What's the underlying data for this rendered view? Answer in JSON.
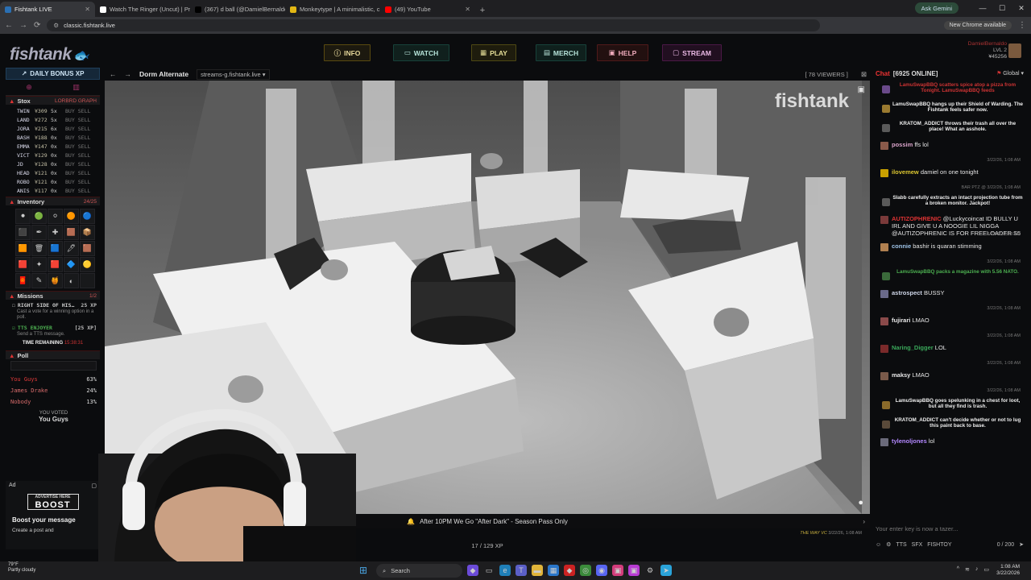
{
  "browser": {
    "tabs": [
      {
        "title": "Fishtank LIVE",
        "active": true,
        "color": "#2a6fb3"
      },
      {
        "title": "Watch The Ringer (Uncut) | Pri",
        "active": false,
        "color": "#ffffff"
      },
      {
        "title": "(367) d ball (@DamielBernaldo",
        "active": false,
        "color": "#000000"
      },
      {
        "title": "Monkeytype | A minimalistic, c",
        "active": false,
        "color": "#e2b714"
      },
      {
        "title": "(49) YouTube",
        "active": false,
        "color": "#ff0000"
      }
    ],
    "url": "classic.fishtank.live",
    "ask_gemini": "Ask Gemini",
    "new_chrome": "New Chrome available"
  },
  "header": {
    "logo": "fishtank",
    "nav": [
      "INFO",
      "WATCH",
      "PLAY",
      "MERCH",
      "HELP",
      "STREAM"
    ],
    "user_name": "DamielBernaldo",
    "user_level": "LVL 2",
    "user_credits": "¥45256"
  },
  "left": {
    "daily_bonus": "DAILY BONUS XP",
    "stox": {
      "title": "Stox",
      "links": "LORBRD  GRAPH",
      "rows": [
        {
          "ticker": "TWIN",
          "price": "¥309",
          "mult": "5x"
        },
        {
          "ticker": "LAND",
          "price": "¥272",
          "mult": "5x"
        },
        {
          "ticker": "JORA",
          "price": "¥215",
          "mult": "6x"
        },
        {
          "ticker": "BASH",
          "price": "¥188",
          "mult": "0x"
        },
        {
          "ticker": "EMMA",
          "price": "¥147",
          "mult": "0x"
        },
        {
          "ticker": "VICT",
          "price": "¥129",
          "mult": "0x"
        },
        {
          "ticker": "JD",
          "price": "¥128",
          "mult": "0x"
        },
        {
          "ticker": "HEAD",
          "price": "¥121",
          "mult": "0x"
        },
        {
          "ticker": "ROBO",
          "price": "¥121",
          "mult": "0x"
        },
        {
          "ticker": "ANIS",
          "price": "¥117",
          "mult": "0x"
        }
      ],
      "buy": "BUY",
      "sell": "SELL"
    },
    "inventory": {
      "title": "Inventory",
      "count": "24/25"
    },
    "missions": {
      "title": "Missions",
      "count": "1/2",
      "items": [
        {
          "name": "RIGHT SIDE OF HIS…",
          "xp": "25 XP",
          "desc": "Cast a vote for a winning option in a poll."
        },
        {
          "name": "TTS ENJOYER",
          "xp": "[25 XP]",
          "desc": "Send a TTS message."
        }
      ],
      "time_label": "TIME REMAINING",
      "time_value": "15:38:31"
    },
    "poll": {
      "title": "Poll",
      "options": [
        {
          "name": "You Guys",
          "pct": "63%",
          "fill": 0.63
        },
        {
          "name": "James Drake",
          "pct": "24%",
          "fill": 0.24
        },
        {
          "name": "Nobody",
          "pct": "13%",
          "fill": 0.13
        }
      ],
      "voted_label": "YOU VOTED",
      "voted_value": "You Guys"
    },
    "ad": {
      "label": "Ad",
      "advertise": "ADVERTISE HERE",
      "boost": "BOOST",
      "title": "Boost your message",
      "desc": "Create a post and"
    }
  },
  "stream": {
    "room": "Dorm Alternate",
    "server": "streams-g.fishtank.live",
    "viewers": "[ 78 VIEWERS ]",
    "watermark": "fishtank",
    "ticker": "After 10PM We Go \"After Dark\" - Season Pass Only",
    "ticker_who": "THE WAY VC",
    "ticker_time": "3/22/26, 1:08 AM",
    "pager": "17 / 129 XP"
  },
  "chat": {
    "title": "Chat",
    "online": "[6925 ONLINE]",
    "room": "Global",
    "messages": [
      {
        "type": "sys",
        "text": "LamuSwapBBQ scatters spice atop a pizza from Tonight. LamuSwapBBQ feeds",
        "color": "#c33"
      },
      {
        "type": "sys",
        "text": "LamuSwapBBQ hangs up their Shield of Warding. The Fishtank feels safer now.",
        "color": "#eee"
      },
      {
        "type": "sys",
        "text": "KRATOM_ADDICT throws their trash all over the place! What an asshole.",
        "color": "#eee"
      },
      {
        "type": "msg",
        "user": "possim",
        "text": "ffs lol",
        "time": "3/22/26, 1:08 AM",
        "ucolor": "#d9a3c9"
      },
      {
        "type": "msg",
        "user": "ilovemew",
        "text": "damiel on one tonight",
        "time": "BAR PTZ @ 3/22/26, 1:08 AM",
        "ucolor": "#d9c430"
      },
      {
        "type": "sys",
        "text": "Slabb carefully extracts an intact projection tube from a broken monitor. Jackpot!",
        "color": "#eee"
      },
      {
        "type": "msg",
        "user": "AUTIZOPHRENIC",
        "text": "@Luckycoincat ID BULLY U IRL AND GIVE U A NOOGIE LIL NIGGA @AUTIZOPHRENIC IS FOR FREELOADER S5",
        "time": "3/22/26, 1:08 AM",
        "ucolor": "#d33"
      },
      {
        "type": "msg",
        "user": "connie",
        "text": "bashir is quaran stimming",
        "time": "3/22/26, 1:08 AM",
        "ucolor": "#9fc4e8"
      },
      {
        "type": "sys",
        "text": "LamuSwapBBQ packs a magazine with 5.56 NATO.",
        "color": "#4caf50"
      },
      {
        "type": "msg",
        "user": "astrospect",
        "text": "BUSSY",
        "time": "3/22/26, 1:08 AM",
        "ucolor": "#cfd6e8"
      },
      {
        "type": "msg",
        "user": "fujirari",
        "text": "LMAO",
        "time": "3/22/26, 1:08 AM",
        "ucolor": "#e8e8e8"
      },
      {
        "type": "msg",
        "user": "Naring_Digger",
        "text": "LOL",
        "time": "3/22/26, 1:08 AM",
        "ucolor": "#3aa85a"
      },
      {
        "type": "msg",
        "user": "maksy",
        "text": "LMAO",
        "time": "3/22/26, 1:08 AM",
        "ucolor": "#e8e8e8"
      },
      {
        "type": "sys",
        "text": "LamuSwapBBQ goes spelunking in a chest for loot, but all they find is trash.",
        "color": "#eee"
      },
      {
        "type": "sys",
        "text": "KRATOM_ADDICT can't decide whether or not to lug this paint back to base.",
        "color": "#eee"
      },
      {
        "type": "msg",
        "user": "tylenoljones",
        "text": "lol",
        "time": "",
        "ucolor": "#b388ff"
      }
    ],
    "input_placeholder": "Your enter key is now a tazer...",
    "footer": [
      "TTS",
      "SFX",
      "FISHTOY"
    ],
    "char_count": "0 / 200"
  },
  "taskbar": {
    "weather_temp": "79°F",
    "weather_desc": "Partly cloudy",
    "search": "Search",
    "time": "1:08 AM",
    "date": "3/22/2026"
  }
}
